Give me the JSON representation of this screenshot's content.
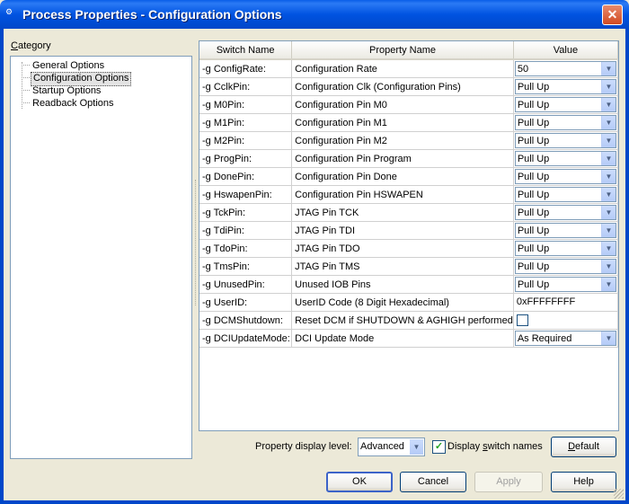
{
  "window": {
    "title": "Process Properties - Configuration Options",
    "close_glyph": "✕",
    "app_icon": "⚙"
  },
  "category": {
    "label_prefix": "",
    "label_accel": "C",
    "label_rest": "ategory",
    "items": [
      "General Options",
      "Configuration Options",
      "Startup Options",
      "Readback Options"
    ],
    "selected_index": 1
  },
  "table": {
    "headers": {
      "switch": "Switch Name",
      "property": "Property Name",
      "value": "Value"
    },
    "rows": [
      {
        "switch": "-g ConfigRate:",
        "property": "Configuration Rate",
        "value": "50",
        "type": "combo"
      },
      {
        "switch": "-g CclkPin:",
        "property": "Configuration Clk (Configuration Pins)",
        "value": "Pull Up",
        "type": "combo"
      },
      {
        "switch": "-g M0Pin:",
        "property": "Configuration Pin M0",
        "value": "Pull Up",
        "type": "combo"
      },
      {
        "switch": "-g M1Pin:",
        "property": "Configuration Pin M1",
        "value": "Pull Up",
        "type": "combo"
      },
      {
        "switch": "-g M2Pin:",
        "property": "Configuration Pin M2",
        "value": "Pull Up",
        "type": "combo"
      },
      {
        "switch": "-g ProgPin:",
        "property": "Configuration Pin Program",
        "value": "Pull Up",
        "type": "combo"
      },
      {
        "switch": "-g DonePin:",
        "property": "Configuration Pin Done",
        "value": "Pull Up",
        "type": "combo"
      },
      {
        "switch": "-g HswapenPin:",
        "property": "Configuration Pin HSWAPEN",
        "value": "Pull Up",
        "type": "combo"
      },
      {
        "switch": "-g TckPin:",
        "property": "JTAG Pin TCK",
        "value": "Pull Up",
        "type": "combo"
      },
      {
        "switch": "-g TdiPin:",
        "property": "JTAG Pin TDI",
        "value": "Pull Up",
        "type": "combo"
      },
      {
        "switch": "-g TdoPin:",
        "property": "JTAG Pin TDO",
        "value": "Pull Up",
        "type": "combo"
      },
      {
        "switch": "-g TmsPin:",
        "property": "JTAG Pin TMS",
        "value": "Pull Up",
        "type": "combo"
      },
      {
        "switch": "-g UnusedPin:",
        "property": "Unused IOB Pins",
        "value": "Pull Up",
        "type": "combo"
      },
      {
        "switch": "-g UserID:",
        "property": "UserID Code (8 Digit Hexadecimal)",
        "value": "0xFFFFFFFF",
        "type": "text"
      },
      {
        "switch": "-g DCMShutdown:",
        "property": "Reset DCM if SHUTDOWN & AGHIGH performed",
        "value": "",
        "type": "checkbox",
        "checked": false
      },
      {
        "switch": "-g DCIUpdateMode:",
        "property": "DCI Update Mode",
        "value": "As Required",
        "type": "combo"
      }
    ]
  },
  "footer": {
    "display_level_label": "Property display level:",
    "display_level_value": "Advanced",
    "display_switch_label_pre": "Display ",
    "display_switch_label_accel": "s",
    "display_switch_label_post": "witch names",
    "display_switch_checked": true,
    "default_label_accel": "D",
    "default_label_rest": "efault"
  },
  "buttons": {
    "ok": "OK",
    "cancel": "Cancel",
    "apply": "Apply",
    "help": "Help"
  },
  "colors": {
    "title_bar": "#0053e1",
    "selection_bg": "#e3e3e3",
    "face": "#ece9d8"
  }
}
